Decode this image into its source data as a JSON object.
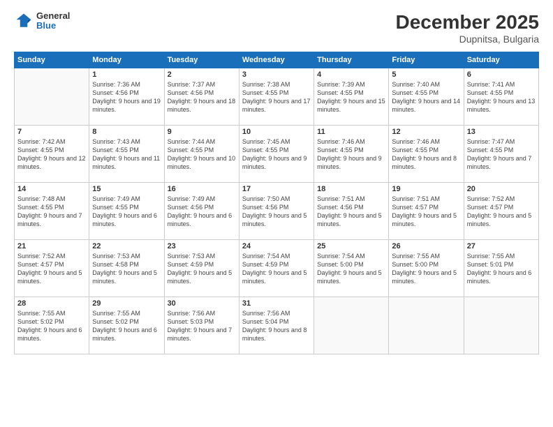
{
  "logo": {
    "general": "General",
    "blue": "Blue"
  },
  "header": {
    "month": "December 2025",
    "location": "Dupnitsa, Bulgaria"
  },
  "weekdays": [
    "Sunday",
    "Monday",
    "Tuesday",
    "Wednesday",
    "Thursday",
    "Friday",
    "Saturday"
  ],
  "weeks": [
    [
      {
        "day": "",
        "info": ""
      },
      {
        "day": "1",
        "info": "Sunrise: 7:36 AM\nSunset: 4:56 PM\nDaylight: 9 hours\nand 19 minutes."
      },
      {
        "day": "2",
        "info": "Sunrise: 7:37 AM\nSunset: 4:56 PM\nDaylight: 9 hours\nand 18 minutes."
      },
      {
        "day": "3",
        "info": "Sunrise: 7:38 AM\nSunset: 4:55 PM\nDaylight: 9 hours\nand 17 minutes."
      },
      {
        "day": "4",
        "info": "Sunrise: 7:39 AM\nSunset: 4:55 PM\nDaylight: 9 hours\nand 15 minutes."
      },
      {
        "day": "5",
        "info": "Sunrise: 7:40 AM\nSunset: 4:55 PM\nDaylight: 9 hours\nand 14 minutes."
      },
      {
        "day": "6",
        "info": "Sunrise: 7:41 AM\nSunset: 4:55 PM\nDaylight: 9 hours\nand 13 minutes."
      }
    ],
    [
      {
        "day": "7",
        "info": "Sunrise: 7:42 AM\nSunset: 4:55 PM\nDaylight: 9 hours\nand 12 minutes."
      },
      {
        "day": "8",
        "info": "Sunrise: 7:43 AM\nSunset: 4:55 PM\nDaylight: 9 hours\nand 11 minutes."
      },
      {
        "day": "9",
        "info": "Sunrise: 7:44 AM\nSunset: 4:55 PM\nDaylight: 9 hours\nand 10 minutes."
      },
      {
        "day": "10",
        "info": "Sunrise: 7:45 AM\nSunset: 4:55 PM\nDaylight: 9 hours\nand 9 minutes."
      },
      {
        "day": "11",
        "info": "Sunrise: 7:46 AM\nSunset: 4:55 PM\nDaylight: 9 hours\nand 9 minutes."
      },
      {
        "day": "12",
        "info": "Sunrise: 7:46 AM\nSunset: 4:55 PM\nDaylight: 9 hours\nand 8 minutes."
      },
      {
        "day": "13",
        "info": "Sunrise: 7:47 AM\nSunset: 4:55 PM\nDaylight: 9 hours\nand 7 minutes."
      }
    ],
    [
      {
        "day": "14",
        "info": "Sunrise: 7:48 AM\nSunset: 4:55 PM\nDaylight: 9 hours\nand 7 minutes."
      },
      {
        "day": "15",
        "info": "Sunrise: 7:49 AM\nSunset: 4:55 PM\nDaylight: 9 hours\nand 6 minutes."
      },
      {
        "day": "16",
        "info": "Sunrise: 7:49 AM\nSunset: 4:56 PM\nDaylight: 9 hours\nand 6 minutes."
      },
      {
        "day": "17",
        "info": "Sunrise: 7:50 AM\nSunset: 4:56 PM\nDaylight: 9 hours\nand 5 minutes."
      },
      {
        "day": "18",
        "info": "Sunrise: 7:51 AM\nSunset: 4:56 PM\nDaylight: 9 hours\nand 5 minutes."
      },
      {
        "day": "19",
        "info": "Sunrise: 7:51 AM\nSunset: 4:57 PM\nDaylight: 9 hours\nand 5 minutes."
      },
      {
        "day": "20",
        "info": "Sunrise: 7:52 AM\nSunset: 4:57 PM\nDaylight: 9 hours\nand 5 minutes."
      }
    ],
    [
      {
        "day": "21",
        "info": "Sunrise: 7:52 AM\nSunset: 4:57 PM\nDaylight: 9 hours\nand 5 minutes."
      },
      {
        "day": "22",
        "info": "Sunrise: 7:53 AM\nSunset: 4:58 PM\nDaylight: 9 hours\nand 5 minutes."
      },
      {
        "day": "23",
        "info": "Sunrise: 7:53 AM\nSunset: 4:59 PM\nDaylight: 9 hours\nand 5 minutes."
      },
      {
        "day": "24",
        "info": "Sunrise: 7:54 AM\nSunset: 4:59 PM\nDaylight: 9 hours\nand 5 minutes."
      },
      {
        "day": "25",
        "info": "Sunrise: 7:54 AM\nSunset: 5:00 PM\nDaylight: 9 hours\nand 5 minutes."
      },
      {
        "day": "26",
        "info": "Sunrise: 7:55 AM\nSunset: 5:00 PM\nDaylight: 9 hours\nand 5 minutes."
      },
      {
        "day": "27",
        "info": "Sunrise: 7:55 AM\nSunset: 5:01 PM\nDaylight: 9 hours\nand 6 minutes."
      }
    ],
    [
      {
        "day": "28",
        "info": "Sunrise: 7:55 AM\nSunset: 5:02 PM\nDaylight: 9 hours\nand 6 minutes."
      },
      {
        "day": "29",
        "info": "Sunrise: 7:55 AM\nSunset: 5:02 PM\nDaylight: 9 hours\nand 6 minutes."
      },
      {
        "day": "30",
        "info": "Sunrise: 7:56 AM\nSunset: 5:03 PM\nDaylight: 9 hours\nand 7 minutes."
      },
      {
        "day": "31",
        "info": "Sunrise: 7:56 AM\nSunset: 5:04 PM\nDaylight: 9 hours\nand 8 minutes."
      },
      {
        "day": "",
        "info": ""
      },
      {
        "day": "",
        "info": ""
      },
      {
        "day": "",
        "info": ""
      }
    ]
  ]
}
